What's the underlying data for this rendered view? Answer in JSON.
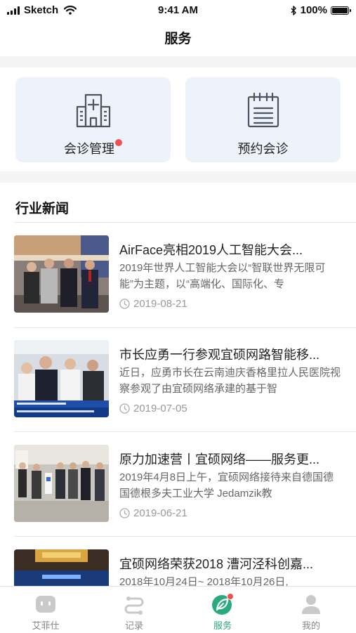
{
  "status_bar": {
    "carrier": "Sketch",
    "time": "9:41 AM",
    "battery": "100%"
  },
  "header": {
    "title": "服务"
  },
  "services": [
    {
      "label": "会诊管理",
      "has_badge": true,
      "icon": "hospital-icon"
    },
    {
      "label": "预约会诊",
      "has_badge": false,
      "icon": "calendar-icon"
    }
  ],
  "news_section": {
    "title": "行业新闻",
    "items": [
      {
        "title": "AirFace亮相2019人工智能大会...",
        "summary": "2019年世界人工智能大会以“智联世界无限可能”为主题，以“高端化、国际化、专",
        "date": "2019-08-21"
      },
      {
        "title": "市长应勇一行参观宜硕网路智能移...",
        "summary": "近日，应勇市长在云南迪庆香格里拉人民医院视察参观了由宜硕网络承建的基于智",
        "date": "2019-07-05"
      },
      {
        "title": "原力加速营丨宜硕网络——服务更...",
        "summary": "2019年4月8日上午，宜硕网络接待来自德国德国德根多夫工业大学 Jedamzik教",
        "date": "2019-06-21"
      },
      {
        "title": "宜硕网络荣获2018 漕河泾科创嘉...",
        "summary": "2018年10月24日~ 2018年10月26日,",
        "date": ""
      }
    ]
  },
  "tabbar": {
    "active_color": "#2aa87e",
    "items": [
      {
        "label": "艾菲仕",
        "icon": "robot-icon",
        "active": false
      },
      {
        "label": "记录",
        "icon": "record-icon",
        "active": false
      },
      {
        "label": "服务",
        "icon": "service-leaf-icon",
        "active": true
      },
      {
        "label": "我的",
        "icon": "user-icon",
        "active": false
      }
    ]
  }
}
